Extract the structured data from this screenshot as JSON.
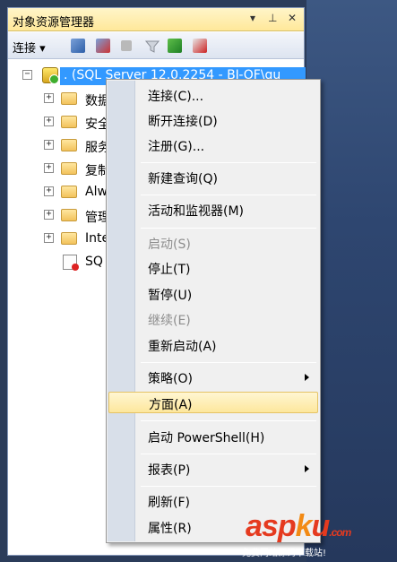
{
  "panel": {
    "title": "对象资源管理器",
    "title_controls": [
      "▾",
      "⊥",
      "✕"
    ]
  },
  "toolbar": {
    "connect_label": "连接 ▾"
  },
  "tree": {
    "server": ". (SQL Server 12.0.2254 - BJ-OF\\gu",
    "items": [
      {
        "label": "数据",
        "expander": "+"
      },
      {
        "label": "安全",
        "expander": "+"
      },
      {
        "label": "服务",
        "expander": "+"
      },
      {
        "label": "复制",
        "expander": "+"
      },
      {
        "label": "Alw",
        "expander": "+"
      },
      {
        "label": "管理",
        "expander": "+"
      },
      {
        "label": "Inte",
        "expander": "+"
      }
    ],
    "agent": "SQ"
  },
  "menu": {
    "items": [
      {
        "label": "连接(C)...",
        "disabled": false
      },
      {
        "label": "断开连接(D)",
        "disabled": false
      },
      {
        "label": "注册(G)...",
        "disabled": false
      },
      {
        "label": "新建查询(Q)",
        "disabled": false
      },
      {
        "label": "活动和监视器(M)",
        "disabled": false
      },
      {
        "label": "启动(S)",
        "disabled": true
      },
      {
        "label": "停止(T)",
        "disabled": false
      },
      {
        "label": "暂停(U)",
        "disabled": false
      },
      {
        "label": "继续(E)",
        "disabled": true
      },
      {
        "label": "重新启动(A)",
        "disabled": false
      },
      {
        "label": "策略(O)",
        "submenu": true
      },
      {
        "label": "方面(A)",
        "selected": true
      },
      {
        "label": "启动 PowerShell(H)",
        "disabled": false
      },
      {
        "label": "报表(P)",
        "submenu": true
      },
      {
        "label": "刷新(F)",
        "disabled": false
      },
      {
        "label": "属性(R)",
        "disabled": false
      }
    ]
  },
  "watermark": {
    "part1": "asp",
    "part2": "k",
    "part3": "u",
    "dot": ".com",
    "sub": "免费网站源码下载站!"
  },
  "colors": {
    "selection": "#3399ff",
    "menu_highlight": "#fde79c"
  }
}
